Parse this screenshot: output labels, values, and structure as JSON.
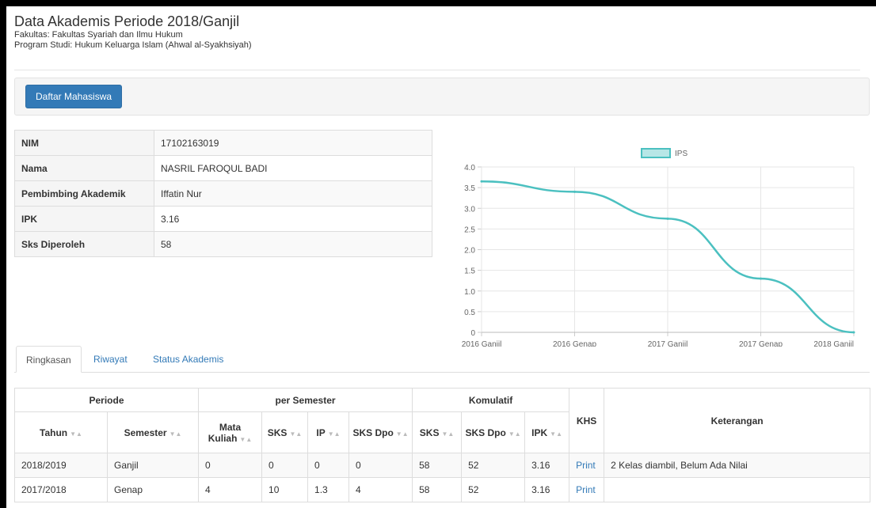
{
  "header": {
    "title": "Data Akademis Periode 2018/Ganjil",
    "faculty": "Fakultas: Fakultas Syariah dan Ilmu Hukum",
    "program": "Program Studi: Hukum Keluarga Islam (Ahwal al-Syakhsiyah)"
  },
  "toolbar": {
    "list_button": "Daftar Mahasiswa"
  },
  "student": {
    "fields": [
      {
        "label": "NIM",
        "value": "17102163019"
      },
      {
        "label": "Nama",
        "value": "NASRIL FAROQUL BADI"
      },
      {
        "label": "Pembimbing Akademik",
        "value": "Iffatin Nur"
      },
      {
        "label": "IPK",
        "value": "3.16"
      },
      {
        "label": "Sks Diperoleh",
        "value": "58"
      }
    ]
  },
  "colors": {
    "primary": "#337ab7",
    "series": "#4bc0c0"
  },
  "chart_data": {
    "type": "line",
    "categories": [
      "2016 Ganjil",
      "2016 Genap",
      "2017 Ganjil",
      "2017 Genap",
      "2018 Ganjil"
    ],
    "series": [
      {
        "name": "IPS",
        "values": [
          3.65,
          3.4,
          2.75,
          1.3,
          0
        ]
      }
    ],
    "ylim": [
      0,
      4.0
    ],
    "yticks": [
      "4.0",
      "3.5",
      "3.0",
      "2.5",
      "2.0",
      "1.5",
      "1.0",
      "0.5",
      "0"
    ],
    "legend": "top",
    "grid": true
  },
  "tabs": [
    {
      "label": "Ringkasan",
      "active": true
    },
    {
      "label": "Riwayat",
      "active": false
    },
    {
      "label": "Status Akademis",
      "active": false
    }
  ],
  "table": {
    "groups": {
      "periode": "Periode",
      "per_semester": "per Semester",
      "komulatif": "Komulatif",
      "khs": "KHS",
      "keterangan": "Keterangan"
    },
    "headers": {
      "tahun": "Tahun",
      "semester": "Semester",
      "mata_kuliah": "Mata Kuliah",
      "sks": "SKS",
      "ip": "IP",
      "sks_dpo": "SKS Dpo",
      "k_sks": "SKS",
      "k_sks_dpo": "SKS Dpo",
      "ipk": "IPK"
    },
    "sort_glyph": "▼▲",
    "rows": [
      [
        "2018/2019",
        "Ganjil",
        "0",
        "0",
        "0",
        "0",
        "58",
        "52",
        "3.16",
        "Print",
        "2 Kelas diambil, Belum Ada Nilai"
      ],
      [
        "2017/2018",
        "Genap",
        "4",
        "10",
        "1.3",
        "4",
        "58",
        "52",
        "3.16",
        "Print",
        ""
      ]
    ]
  }
}
